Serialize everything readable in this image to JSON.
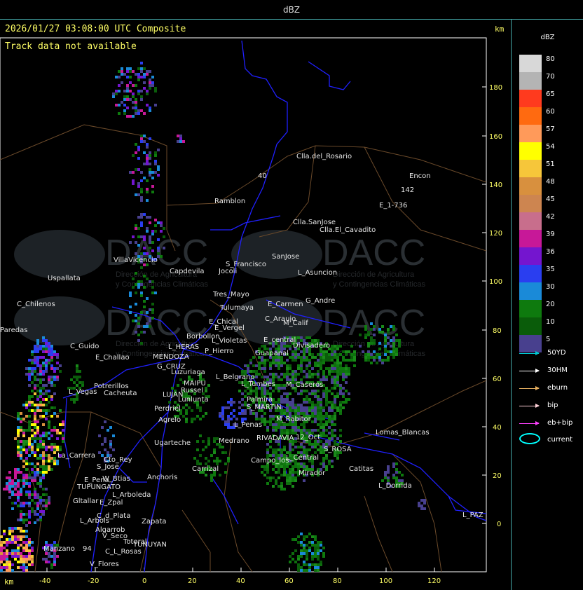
{
  "window": {
    "title": "dBZ"
  },
  "header": {
    "timestamp": "2026/01/27 03:08:00 UTC Composite",
    "track_status": "Track data not available",
    "unit_top": "km",
    "unit_bottom": "km"
  },
  "axes": {
    "x_ticks": [
      "-40",
      "-20",
      "0",
      "20",
      "40",
      "60",
      "80",
      "100",
      "120"
    ],
    "y_ticks": [
      "180",
      "160",
      "140",
      "120",
      "100",
      "80",
      "60",
      "40",
      "20",
      "0"
    ]
  },
  "watermark": {
    "brand": "DACC",
    "line1": "Dirección de Agricultura",
    "line2": "y Contingencias Climáticas"
  },
  "places": [
    "Clla.del_Rosario",
    "Encon",
    "142",
    "E_1-736",
    "Ramblon",
    "40",
    "Clla.SanJose",
    "Clla.El_Cavadito",
    "Uspallata",
    "VillaVicencio",
    "Capdevila",
    "S_Francisco",
    "SanJose",
    "L_Asuncion",
    "Jocoli",
    "C_Chilenos",
    "Tres_Mayo",
    "Tulumaya",
    "E_Carmen",
    "G_Andre",
    "C_Araujo",
    "E_Chical",
    "E_Vergel",
    "M_Calif",
    "Paredas",
    "Borbollon",
    "L_Violetas",
    "E_central",
    "Divisadero",
    "C_Guido",
    "L_HERAS",
    "P_Hierro",
    "E_Challao",
    "MENDOZA",
    "G_CRUZ",
    "Luzuriaga",
    "Guapanal",
    "L_Belgrano",
    "Potrerillos",
    "Cacheuta",
    "MAIPU",
    "Russel",
    "L_Tumbes",
    "M_Caseros",
    "L_Vegas",
    "LUJAN",
    "Lunlunta",
    "Palmira",
    "Perdriel",
    "S_MARTIN",
    "Agrelo",
    "M_Rabitor",
    "L_Penas",
    "Ugarteche",
    "Lomas_Blancas",
    "RIVADAVIA",
    "12_Oct",
    "Medrano",
    "La_Carrera",
    "Cto_Rey",
    "S_Jose",
    "S_ROSA",
    "Campo_los",
    "L_Central",
    "Carrizal",
    "Catitas",
    "W_Btias",
    "Anchoris",
    "E_Pena",
    "TUPUNGATO",
    "Mirador",
    "L_Dorrida",
    "L_Arboleda",
    "Gltallar",
    "E_Zpal",
    "L_PAZ",
    "C_d_Plata",
    "L_Arbols",
    "Zapata",
    "Algarrob",
    "V_Seco",
    "Totoral",
    "Manzano",
    "TUNUYAN",
    "C_L_Rosas",
    "V_Flores",
    "94"
  ],
  "legend": {
    "title": "dBZ",
    "scale": [
      {
        "label": "80",
        "color": "#d8d8d8"
      },
      {
        "label": "70",
        "color": "#b4b4b4"
      },
      {
        "label": "65",
        "color": "#ff3a1e"
      },
      {
        "label": "60",
        "color": "#ff6a10"
      },
      {
        "label": "57",
        "color": "#ff9a5a"
      },
      {
        "label": "54",
        "color": "#ffff00"
      },
      {
        "label": "51",
        "color": "#f6c63a"
      },
      {
        "label": "48",
        "color": "#d8903e"
      },
      {
        "label": "45",
        "color": "#cd8550"
      },
      {
        "label": "42",
        "color": "#c86e8c"
      },
      {
        "label": "39",
        "color": "#c71898"
      },
      {
        "label": "36",
        "color": "#7415cf"
      },
      {
        "label": "35",
        "color": "#2a3ef0"
      },
      {
        "label": "30",
        "color": "#1a8ad8"
      },
      {
        "label": "20",
        "color": "#0e7a0e"
      },
      {
        "label": "10",
        "color": "#0a5c0a"
      },
      {
        "label": "5",
        "color": "#48408e"
      }
    ],
    "tracks": [
      {
        "label": "50YD",
        "color": "#00c8d0"
      },
      {
        "label": "30HM",
        "color": "#ffffff"
      },
      {
        "label": "eburn",
        "color": "#e8b060"
      },
      {
        "label": "bip",
        "color": "#ffd0d8"
      },
      {
        "label": "eb+bip",
        "color": "#ff40ff"
      }
    ],
    "current_label": "current",
    "current_color": "#00ffff"
  }
}
